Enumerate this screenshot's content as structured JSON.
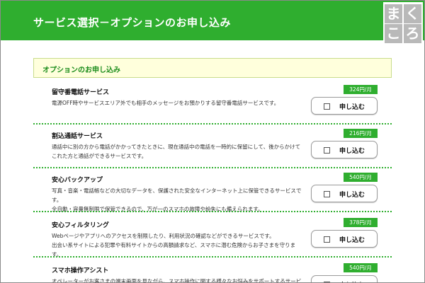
{
  "header": {
    "title": "サービス選択－オプションのお申し込み",
    "logo_chars": [
      "ま",
      "く",
      "こ",
      "ろ"
    ]
  },
  "section": {
    "title": "オプションのお申し込み"
  },
  "apply_label": "申し込む",
  "options": [
    {
      "name": "留守番電話サービス",
      "price": "324円/月",
      "desc": [
        "電源OFF時やサービスエリア外でも相手のメッセージをお預かりする留守番電話サービスです。"
      ]
    },
    {
      "name": "割込通話サービス",
      "price": "216円/月",
      "desc": [
        "通話中に別の方から電話がかかってきたときに、現在通話中の電話を一時的に保留にして、後からかけて",
        "これた方と通話ができるサービスです。"
      ]
    },
    {
      "name": "安心バックアップ",
      "price": "540円/月",
      "desc": [
        "写真・音楽・電話帳などの大切なデータを、保護された安全なインターネット上に保管できるサービスで",
        "す。",
        "全自動・容量無制限で保管できるので、万が一のスマホの故障や紛失にも備えられます。"
      ]
    },
    {
      "name": "安心フィルタリング",
      "price": "378円/月",
      "desc": [
        "Webページやアプリへのアクセスを制限したり、利用状況の確認などができるサービスです。",
        "出会い系サイトによる犯罪や有料サイトからの高額請求など、スマホに潜む危険からお子さまを守りま",
        "す。"
      ]
    },
    {
      "name": "スマホ操作アシスト",
      "price": "540円/月",
      "desc": [
        "オペレーターがお客さまの端末画面を見ながら、スマホ操作に関する様々なお悩みをサポートするサービ"
      ]
    }
  ],
  "colors": {
    "brand_green": "#2fae2f",
    "section_bg": "#ffffdc"
  }
}
